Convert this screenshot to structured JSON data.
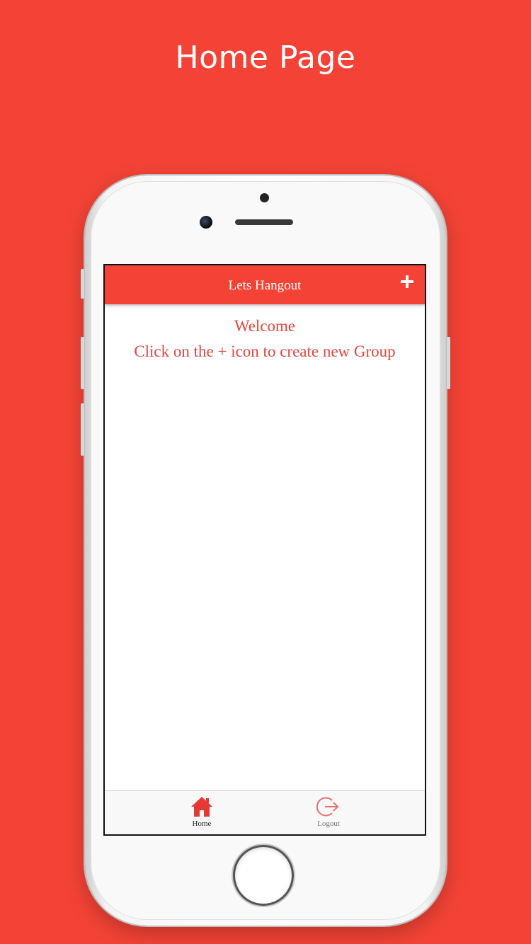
{
  "page": {
    "heading": "Home Page"
  },
  "app": {
    "header": {
      "title": "Lets Hangout",
      "action_icon": "plus-icon"
    },
    "content": {
      "welcome": "Welcome",
      "instruction": "Click on the + icon to create new Group"
    },
    "tabs": [
      {
        "label": "Home",
        "icon": "home-icon",
        "active": true
      },
      {
        "label": "Logout",
        "icon": "logout-icon",
        "active": false
      }
    ]
  },
  "colors": {
    "background": "#f44336",
    "header": "#f44336",
    "text_accent": "#e2463e",
    "tab_active": "#e53935"
  }
}
